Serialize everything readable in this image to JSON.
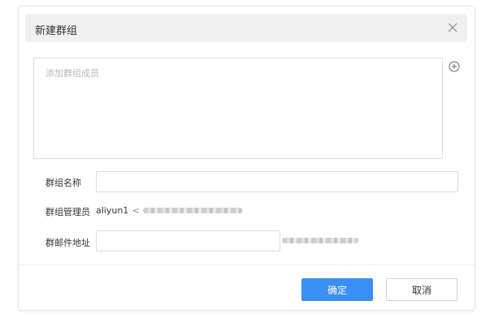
{
  "dialog": {
    "title": "新建群组",
    "close_icon": "close-icon",
    "add_icon": "plus-circle-icon"
  },
  "members": {
    "placeholder": "添加群组成员"
  },
  "form": {
    "group_name_label": "群组名称",
    "group_name_value": "",
    "admin_label": "群组管理员",
    "admin_user": "aliyun1",
    "admin_separator": "<",
    "email_label": "群邮件地址",
    "email_value": ""
  },
  "buttons": {
    "confirm": "确定",
    "cancel": "取消"
  },
  "colors": {
    "primary": "#3b8ef3",
    "header_bg": "#f0f0f0",
    "border": "#dcdcdc"
  }
}
